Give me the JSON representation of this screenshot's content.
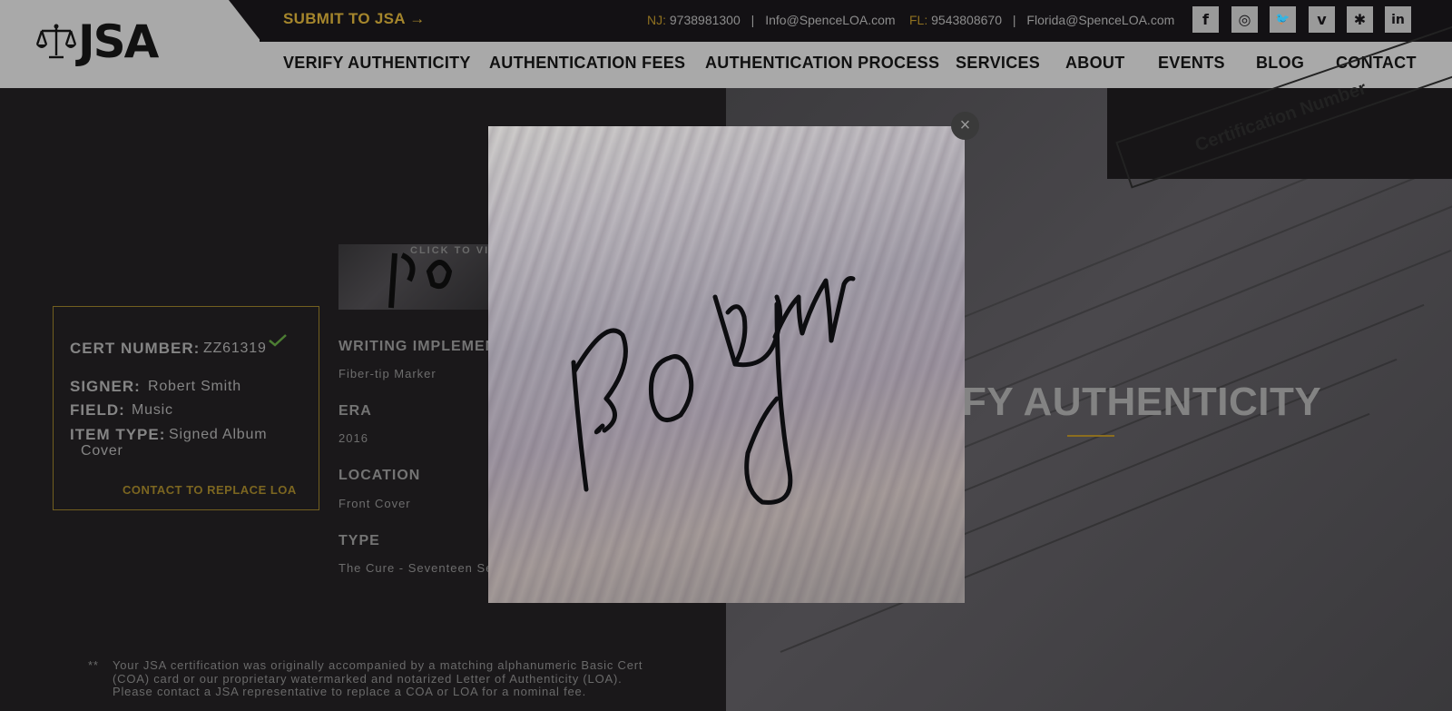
{
  "header": {
    "logo_text": "JSA",
    "submit_label": "SUBMIT TO JSA",
    "submit_arrow": "→",
    "contacts": [
      {
        "label": "NJ:",
        "phone": "9738981300",
        "email": "Info@SpenceLOA.com"
      },
      {
        "label": "FL:",
        "phone": "9543808670",
        "email": "Florida@SpenceLOA.com"
      }
    ],
    "separator": "|",
    "social": [
      {
        "name": "facebook-icon",
        "glyph": "f"
      },
      {
        "name": "instagram-icon",
        "glyph": "◎"
      },
      {
        "name": "twitter-icon",
        "glyph": "🐦"
      },
      {
        "name": "vimeo-icon",
        "glyph": "v"
      },
      {
        "name": "yelp-icon",
        "glyph": "✱"
      },
      {
        "name": "linkedin-icon",
        "glyph": "in"
      }
    ],
    "nav": [
      "VERIFY AUTHENTICITY",
      "AUTHENTICATION FEES",
      "AUTHENTICATION PROCESS",
      "SERVICES",
      "ABOUT",
      "EVENTS",
      "BLOG",
      "CONTACT"
    ]
  },
  "cert": {
    "number_label": "CERT NUMBER:",
    "number_value": "ZZ61319",
    "signer_label": "SIGNER:",
    "signer_value": "Robert Smith",
    "field_label": "FIELD:",
    "field_value": "Music",
    "item_type_label": "ITEM TYPE:",
    "item_type_value_1": "Signed Album",
    "item_type_value_2": "Cover",
    "replace_link": "CONTACT TO REPLACE LOA"
  },
  "details": {
    "thumb_caption": "CLICK TO VI",
    "writing_label": "WRITING IMPLEMENT",
    "writing_value": "Fiber-tip Marker",
    "era_label": "ERA",
    "era_value": "2016",
    "location_label": "LOCATION",
    "location_value": "Front Cover",
    "type_label": "TYPE",
    "type_value": "The Cure - Seventeen Sec"
  },
  "footnote": {
    "mark": "**",
    "text": "Your JSA certification was originally accompanied by a matching alphanumeric Basic Cert (COA) card or our proprietary watermarked and notarized Letter of Authenticity (LOA). Please contact a JSA representative to replace a COA or LOA for a nominal fee."
  },
  "hero": {
    "title": "FY AUTHENTICITY",
    "doc_cert": "Certification Number"
  },
  "modal": {
    "close_label": "×"
  },
  "colors": {
    "gold": "#a5862c",
    "header_gray": "#a9a9a9",
    "topbar": "#131114"
  }
}
